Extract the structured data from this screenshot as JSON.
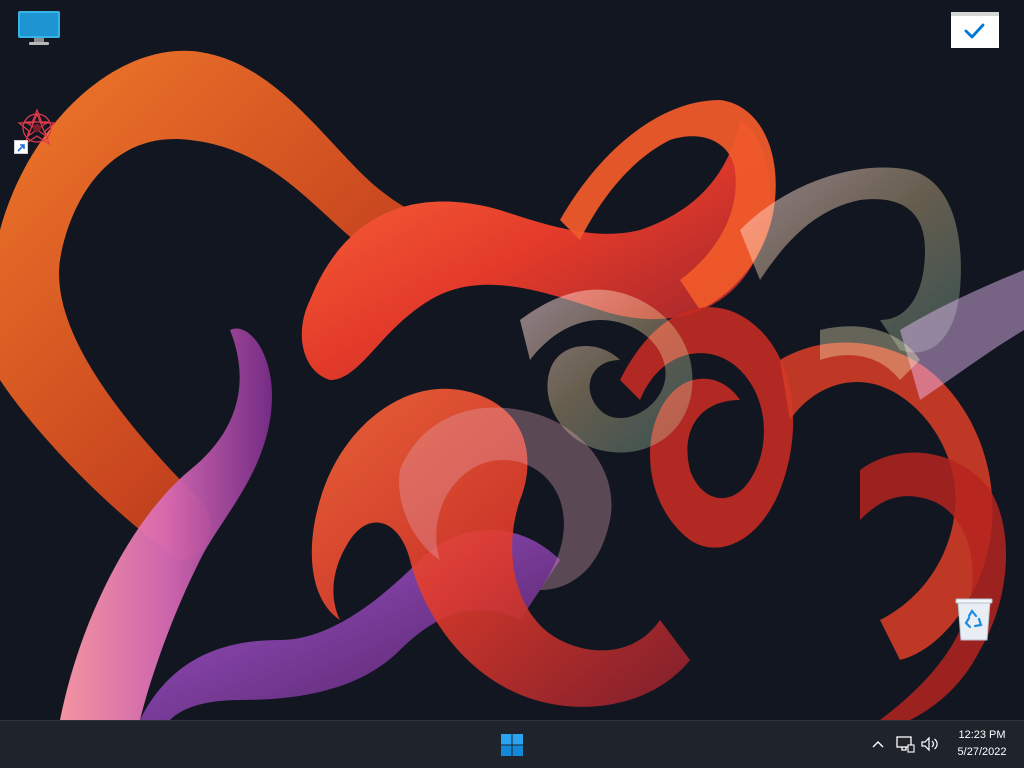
{
  "desktop": {
    "icons": [
      {
        "name": "this-pc",
        "label": ""
      },
      {
        "name": "app-shortcut",
        "label": ""
      },
      {
        "name": "recycle-bin",
        "label": ""
      }
    ],
    "widget": {
      "icon": "checkmark-icon"
    }
  },
  "taskbar": {
    "start_icon": "windows-logo-icon",
    "tray": {
      "chevron_icon": "chevron-up-icon",
      "network_icon": "network-icon",
      "volume_icon": "volume-icon"
    },
    "clock": {
      "time": "12:23 PM",
      "date": "5/27/2022"
    }
  },
  "colors": {
    "accent": "#0078d4",
    "taskbar": "#1f232b",
    "desktop": "#121621"
  }
}
